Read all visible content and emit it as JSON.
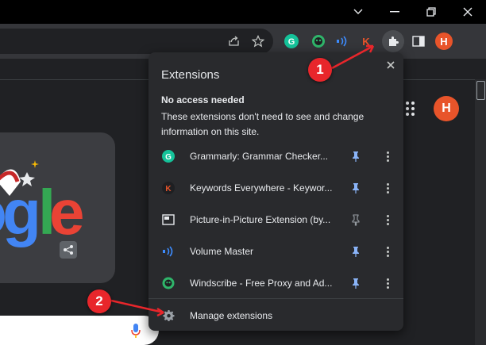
{
  "window": {
    "controls": [
      "chevron-down",
      "minimize",
      "restore",
      "close"
    ]
  },
  "toolbar": {
    "avatar_letter": "H",
    "extension_icons": [
      {
        "name": "grammarly",
        "color": "#15c39a"
      },
      {
        "name": "windscribe",
        "color": "#2fb56a"
      },
      {
        "name": "volume-master",
        "color": "#3d8cff"
      },
      {
        "name": "keywords-everywhere",
        "color": "#e8542a"
      }
    ]
  },
  "page": {
    "avatar_letter": "H"
  },
  "extensions_popup": {
    "title": "Extensions",
    "section_heading": "No access needed",
    "section_description": "These extensions don't need to see and change information on this site.",
    "items": [
      {
        "name": "Grammarly: Grammar Checker...",
        "icon": "grammarly-icon",
        "pinned": true
      },
      {
        "name": "Keywords Everywhere - Keywor...",
        "icon": "keywords-everywhere-icon",
        "pinned": true
      },
      {
        "name": "Picture-in-Picture Extension (by...",
        "icon": "picture-in-picture-icon",
        "pinned": false
      },
      {
        "name": "Volume Master",
        "icon": "volume-master-icon",
        "pinned": true
      },
      {
        "name": "Windscribe - Free Proxy and Ad...",
        "icon": "windscribe-icon",
        "pinned": true
      }
    ],
    "manage_label": "Manage extensions"
  },
  "annotations": {
    "callout_1": "1",
    "callout_2": "2",
    "color": "#e8262b"
  },
  "colors": {
    "pin_active": "#8ab4f8",
    "pin_inactive": "#9aa0a6",
    "popup_bg": "#292a2d",
    "toolbar_bg": "#35363a"
  }
}
